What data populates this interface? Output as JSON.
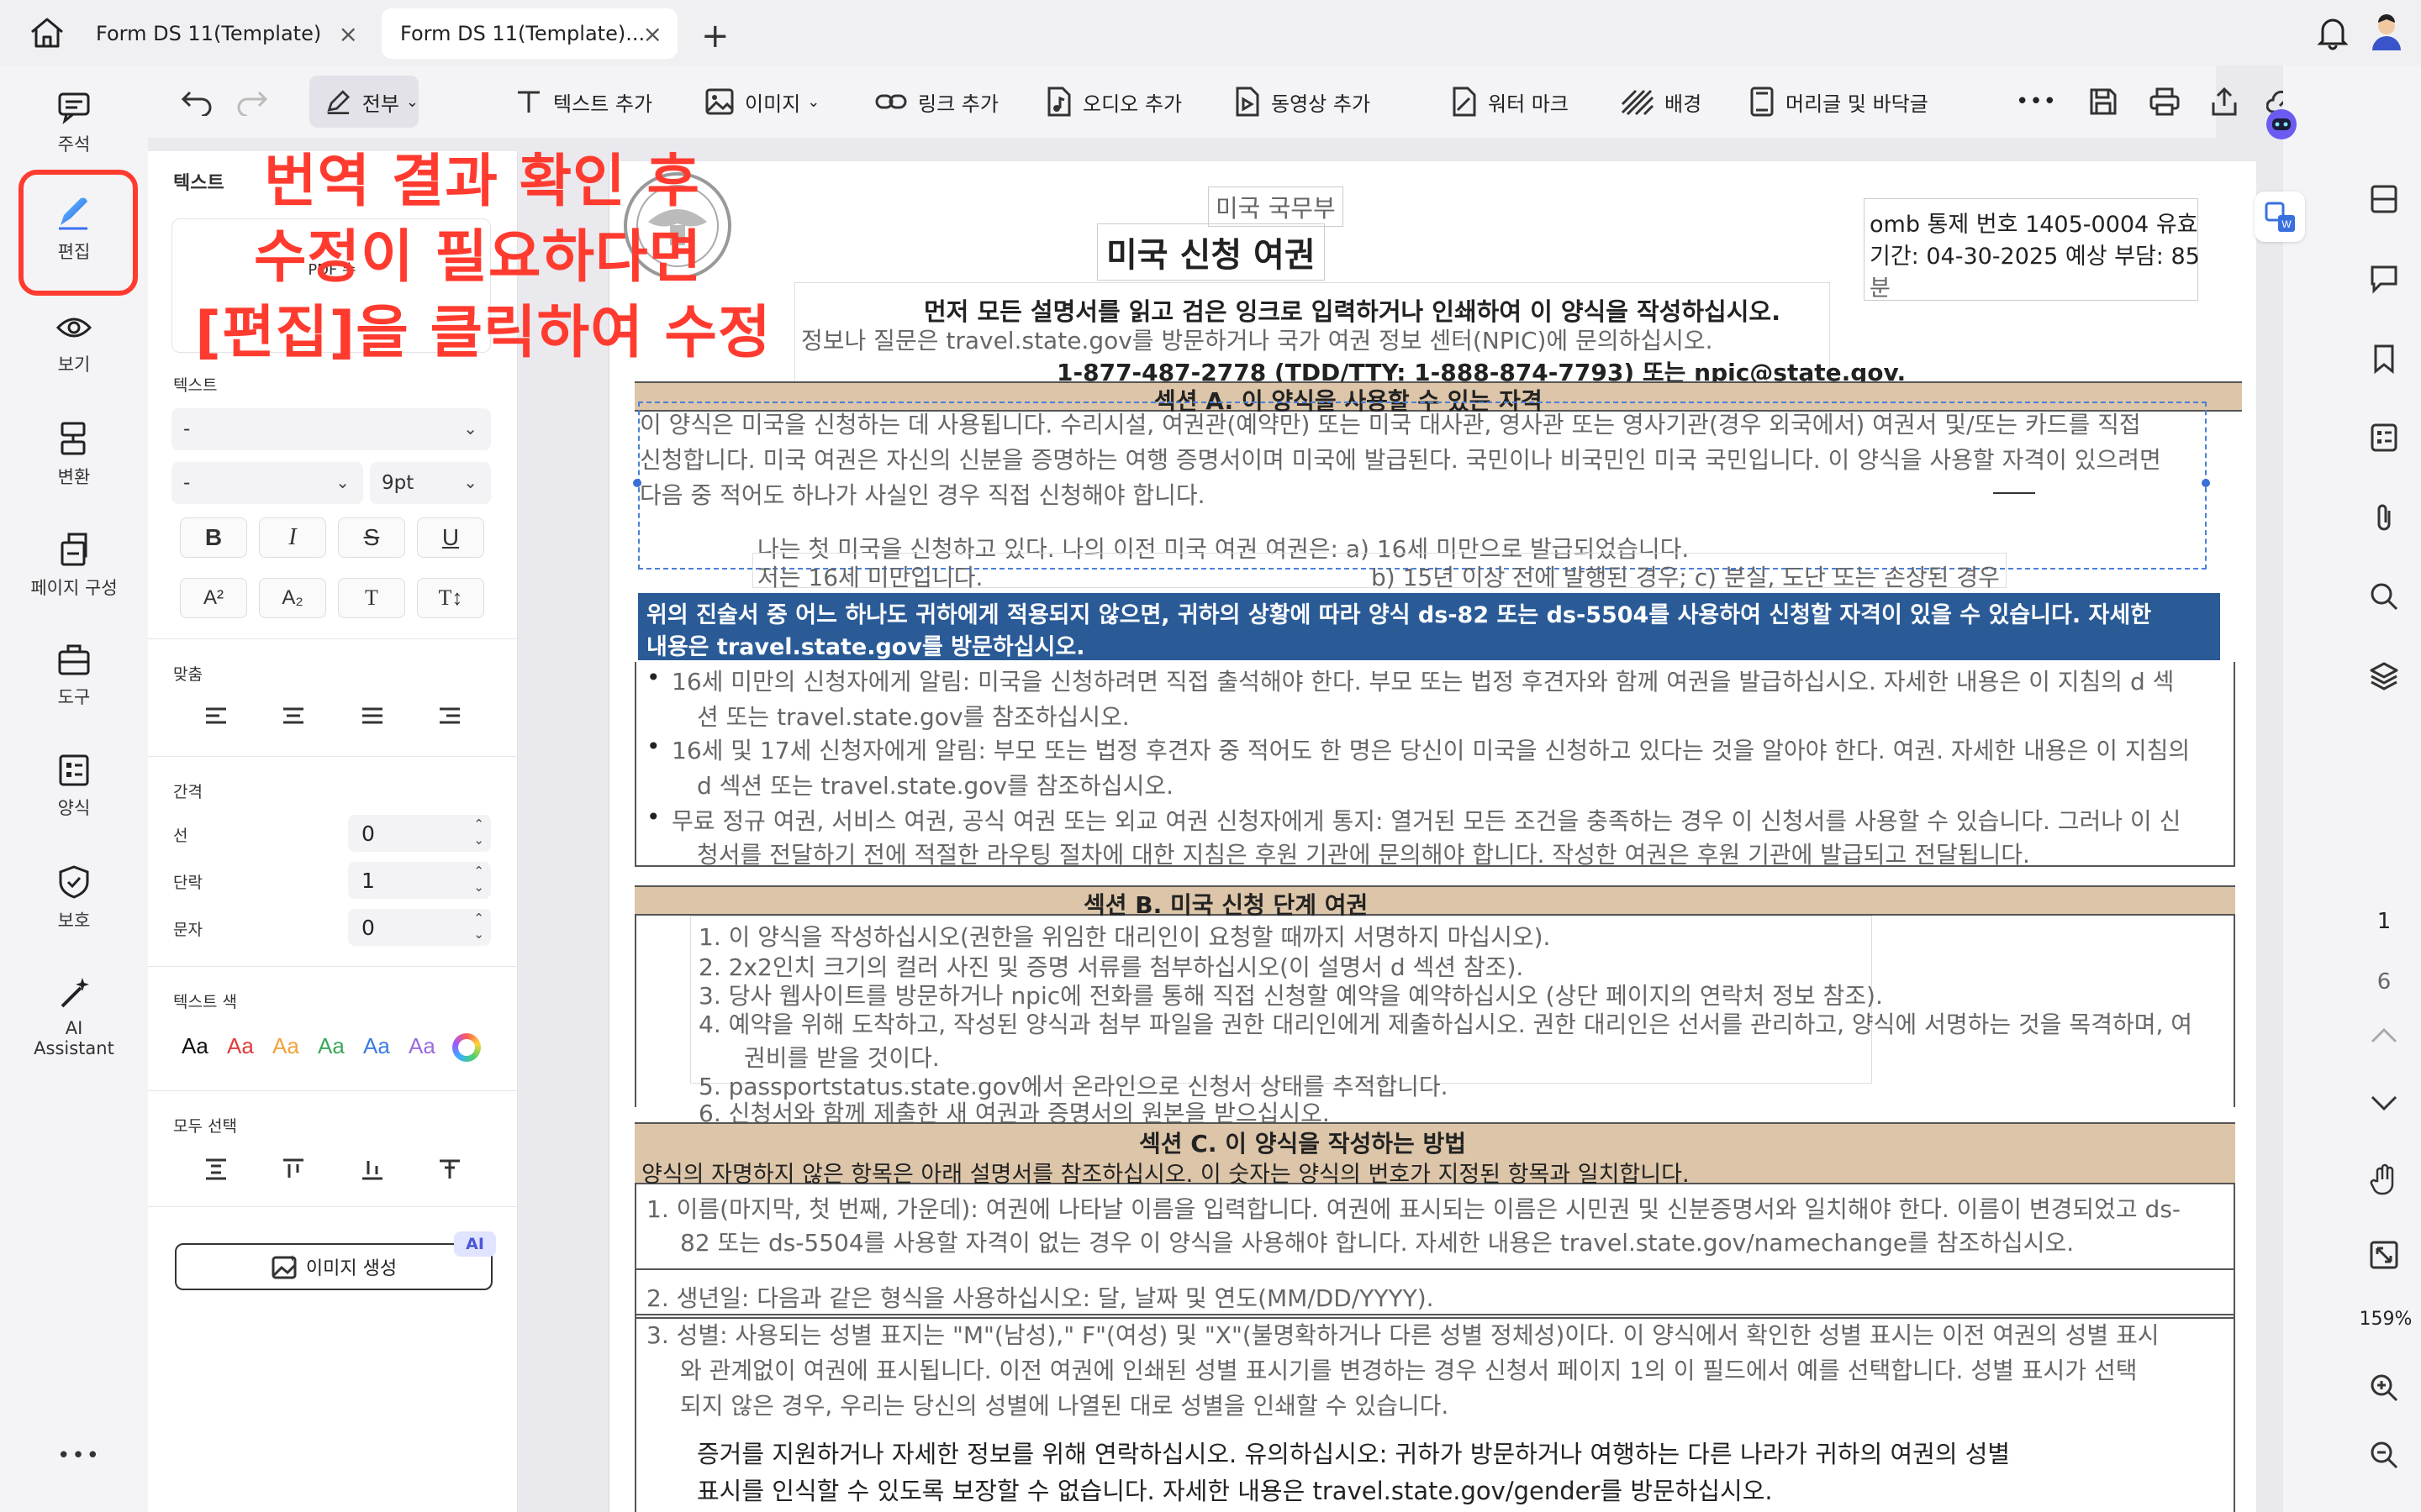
{
  "tabs": [
    {
      "label": "Form DS 11(Template)",
      "active": false
    },
    {
      "label": "Form DS 11(Template)...",
      "active": true
    }
  ],
  "leftnav": [
    {
      "label": "주석",
      "icon": "comment-icon"
    },
    {
      "label": "편집",
      "icon": "edit-icon",
      "active": true
    },
    {
      "label": "보기",
      "icon": "eye-icon"
    },
    {
      "label": "변환",
      "icon": "convert-icon"
    },
    {
      "label": "페이지 구성",
      "icon": "page-organize-icon"
    },
    {
      "label": "도구",
      "icon": "toolbox-icon"
    },
    {
      "label": "양식",
      "icon": "form-icon"
    },
    {
      "label": "보호",
      "icon": "shield-icon"
    },
    {
      "label_line1": "AI",
      "label_line2": "Assistant",
      "icon": "ai-wand-icon"
    }
  ],
  "toolbar": {
    "all_label": "전부",
    "add_text": "텍스트 추가",
    "image": "이미지",
    "add_link": "링크 추가",
    "add_audio": "오디오 추가",
    "add_video": "동영상 추가",
    "watermark": "워터 마크",
    "background": "배경",
    "header_footer": "머리글 및 바닥글",
    "more": "•••"
  },
  "panel": {
    "section_text_title": "텍스트",
    "preview_text": "PDF 수",
    "text_label": "텍스트",
    "font_family": "-",
    "font_style": "-",
    "font_size": "9pt",
    "align_label": "맞춤",
    "spacing_label": "간격",
    "line_label": "선",
    "line_value": "0",
    "paragraph_label": "단락",
    "paragraph_value": "1",
    "char_label": "문자",
    "char_value": "0",
    "text_color_label": "텍스트 색",
    "swatch_text": "Aa",
    "swatch_colors": [
      "#111111",
      "#e03a3a",
      "#f2a23c",
      "#3aa85a",
      "#3a7be0",
      "#9b6be0"
    ],
    "select_all_label": "모두 선택",
    "generate_image": "이미지 생성",
    "ai_badge": "AI"
  },
  "annotation": {
    "line1": "번역 결과 확인 후",
    "line2": "수정이 필요하다면",
    "line3": "[편집]을 클릭하여 수정"
  },
  "document": {
    "dept": "미국 국무부",
    "title": "미국 신청 여권",
    "omb_line1": "omb 통제 번호 1405-0004 유효",
    "omb_line2": "기간: 04-30-2025 예상 부담: 85",
    "omb_line3": "분",
    "instr_bold": "먼저 모든 설명서를 읽고 검은 잉크로 입력하거나 인쇄하여 이 양식을 작성하십시오.",
    "instr_info": "정보나 질문은 travel.state.gov를 방문하거나 국가 여권 정보 센터(NPIC)에 문의하십시오.",
    "instr_phone": "1-877-487-2778 (TDD/TTY: 1-888-874-7793) 또는 npic@state.gov.",
    "secA_title": "섹션 A. 이 양식을 사용할 수 있는 자격",
    "secA_p1": "이 양식은 미국을 신청하는 데 사용됩니다. 수리시설, 여권관(예약만) 또는 미국 대사관, 영사관 또는 영사기관(경우 외국에서) 여권서 및/또는 카드를 직접",
    "secA_p2": "신청합니다. 미국 여권은 자신의 신분을 증명하는 여행 증명서이며 미국에 발급된다. 국민이나 비국민인 미국 국민입니다. 이 양식을 사용할 자격이 있으려면",
    "secA_p3": "다음 중 적어도 하나가 사실인 경우 직접 신청해야 합니다.",
    "secA_q1": "나는 첫 미국을 신청하고 있다. 나의 이전 미국 여권 여권은: a) 16세 미만으로 발급되었습니다.",
    "secA_q2a": "저는 16세 미만입니다.",
    "secA_q2b": "b) 15년 이상 전에 발행된 경우; c) 분실, 도난 또는 손상된 경우",
    "secA_banner1": "위의 진술서 중 어느 하나도 귀하에게 적용되지 않으면, 귀하의 상황에 따라 양식 ds-82 또는 ds-5504를 사용하여 신청할 자격이 있을 수 있습니다. 자세한",
    "secA_banner2": "내용은 travel.state.gov를 방문하십시오.",
    "secA_b1a": "16세 미만의 신청자에게 알림: 미국을 신청하려면 직접 출석해야 한다. 부모 또는 법정 후견자와 함께 여권을 발급하십시오. 자세한 내용은 이 지침의 d 섹",
    "secA_b1b": "션 또는 travel.state.gov를 참조하십시오.",
    "secA_b2a": "16세 및 17세 신청자에게 알림: 부모 또는 법정 후견자 중 적어도 한 명은 당신이 미국을 신청하고 있다는 것을 알아야 한다. 여권. 자세한 내용은 이 지침의",
    "secA_b2b": "d 섹션 또는 travel.state.gov를 참조하십시오.",
    "secA_b3a": "무료 정규 여권, 서비스 여권, 공식 여권 또는 외교 여권 신청자에게 통지: 열거된 모든 조건을 충족하는 경우 이 신청서를 사용할 수 있습니다. 그러나 이 신",
    "secA_b3b": "청서를 전달하기 전에 적절한 라우팅 절차에 대한 지침은 후원 기관에 문의해야 합니다. 작성한 여권은 후원 기관에 발급되고 전달됩니다.",
    "secB_title": "섹션 B. 미국 신청 단계 여권",
    "secB_items": [
      "1. 이 양식을 작성하십시오(권한을 위임한 대리인이 요청할 때까지 서명하지 마십시오).",
      "2. 2x2인치 크기의 컬러 사진 및 증명 서류를 첨부하십시오(이 설명서 d 섹션 참조).",
      "3. 당사 웹사이트를 방문하거나 npic에 전화를 통해 직접 신청할 예약을 예약하십시오 (상단 페이지의 연락처 정보 참조).",
      "4. 예약을 위해 도착하고, 작성된 양식과 첨부 파일을 권한 대리인에게 제출하십시오. 권한 대리인은 선서를 관리하고, 양식에 서명하는 것을 목격하며, 여",
      "권비를 받을 것이다.",
      "5. passportstatus.state.gov에서 온라인으로 신청서 상태를 추적합니다.",
      "6. 신청서와 함께 제출한 새 여권과 증명서의 원본을 받으십시오."
    ],
    "secC_title": "섹션 C. 이 양식을 작성하는 방법",
    "secC_sub": "양식의 자명하지 않은 항목은 아래 설명서를 참조하십시오. 이 숫자는 양식의 번호가 지정된 항목과 일치합니다.",
    "secC_1a": "1. 이름(마지막, 첫 번째, 가운데): 여권에 나타날 이름을 입력합니다. 여권에 표시되는 이름은 시민권 및 신분증명서와 일치해야 한다. 이름이 변경되었고 ds-",
    "secC_1b": "82 또는 ds-5504를 사용할 자격이 없는 경우 이 양식을 사용해야 합니다. 자세한 내용은 travel.state.gov/namechange를 참조하십시오.",
    "secC_2": "2. 생년일: 다음과 같은 형식을 사용하십시오: 달, 날짜 및 연도(MM/DD/YYYY).",
    "secC_3a": "3. 성별: 사용되는 성별 표지는 \"M\"(남성),\" F\"(여성) 및 \"X\"(불명확하거나 다른 성별 정체성)이다. 이 양식에서 확인한 성별 표시는 이전 여권의 성별 표시",
    "secC_3b": "와 관계없이 여권에 표시됩니다. 이전 여권에 인쇄된 성별 표시기를 변경하는 경우 신청서 페이지 1의 이 필드에서 예를 선택합니다. 성별 표시가 선택",
    "secC_3c": "되지 않은 경우, 우리는 당신의 성별에 나열된 대로 성별을 인쇄할 수 있습니다.",
    "secC_3d": "증거를 지원하거나 자세한 정보를 위해 연락하십시오. 유의하십시오: 귀하가 방문하거나 여행하는 다른 나라가 귀하의 여권의 성별",
    "secC_3e": "표시를 인식할 수 있도록 보장할 수 없습니다. 자세한 내용은 travel.state.gov/gender를 방문하십시오."
  },
  "rightrail": {
    "page_current": "1",
    "page_total": "6",
    "zoom": "159%"
  }
}
